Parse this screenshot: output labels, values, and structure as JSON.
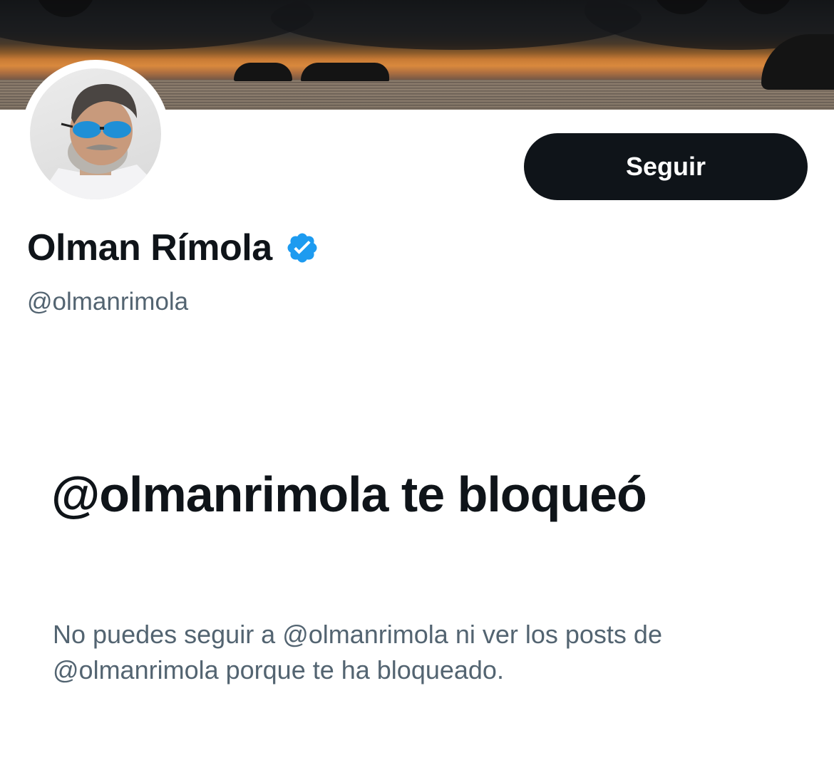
{
  "profile": {
    "display_name": "Olman Rímola",
    "handle": "@olmanrimola",
    "verified": true,
    "follow_label": "Seguir"
  },
  "blocked": {
    "title": "@olmanrimola te bloqueó",
    "description": "No puedes seguir a @olmanrimola ni ver los posts de @olmanrimola porque te ha bloqueado."
  },
  "colors": {
    "verified_badge": "#1d9bf0",
    "follow_button_bg": "#0f1419",
    "secondary_text": "#536471"
  },
  "icons": {
    "verified": "verified-badge-icon"
  }
}
